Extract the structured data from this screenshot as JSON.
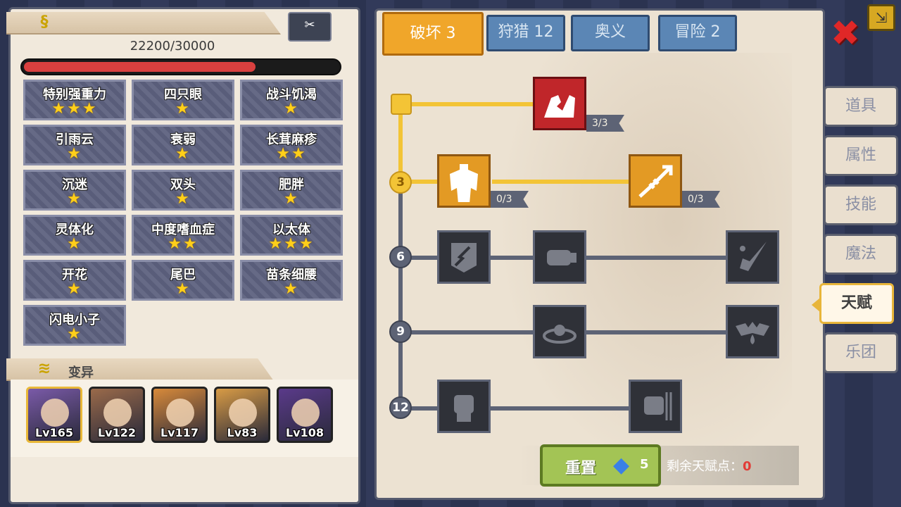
{
  "hp": {
    "text": "22200/30000",
    "fraction": 0.74
  },
  "traits": [
    {
      "name": "特别强重力",
      "stars": 3
    },
    {
      "name": "四只眼",
      "stars": 1
    },
    {
      "name": "战斗饥渴",
      "stars": 1
    },
    {
      "name": "引雨云",
      "stars": 1
    },
    {
      "name": "衰弱",
      "stars": 1
    },
    {
      "name": "长茸麻疹",
      "stars": 2
    },
    {
      "name": "沉迷",
      "stars": 1
    },
    {
      "name": "双头",
      "stars": 1
    },
    {
      "name": "肥胖",
      "stars": 1
    },
    {
      "name": "灵体化",
      "stars": 1
    },
    {
      "name": "中度嗜血症",
      "stars": 2
    },
    {
      "name": "以太体",
      "stars": 3
    },
    {
      "name": "开花",
      "stars": 1
    },
    {
      "name": "尾巴",
      "stars": 1
    },
    {
      "name": "苗条细腰",
      "stars": 1
    },
    {
      "name": "闪电小子",
      "stars": 1
    }
  ],
  "mutation": {
    "label": "变异"
  },
  "characters": [
    {
      "level": "Lv165",
      "selected": true,
      "color": "#7a5aa8"
    },
    {
      "level": "Lv122",
      "selected": false,
      "color": "#9a6a4a"
    },
    {
      "level": "Lv117",
      "selected": false,
      "color": "#d88a3a"
    },
    {
      "level": "Lv83",
      "selected": false,
      "color": "#d89b45"
    },
    {
      "level": "Lv108",
      "selected": false,
      "color": "#5a3a8a"
    }
  ],
  "top_tabs": [
    {
      "label": "破坏 3",
      "active": true
    },
    {
      "label": "狩猎 12",
      "active": false
    },
    {
      "label": "奥义",
      "active": false
    },
    {
      "label": "冒险 2",
      "active": false
    }
  ],
  "tiers": [
    "3",
    "6",
    "9",
    "12"
  ],
  "talents": {
    "arm_wrestle": {
      "icon": "arm-wrestle",
      "progress": "3/3",
      "state": "owned"
    },
    "muscle": {
      "icon": "muscle",
      "progress": "0/3",
      "state": "available"
    },
    "arrow_break": {
      "icon": "arrow-break",
      "progress": "0/3",
      "state": "available"
    },
    "shield_break": {
      "icon": "shield-break",
      "state": "locked"
    },
    "punch": {
      "icon": "punch",
      "state": "locked"
    },
    "splash": {
      "icon": "splash",
      "state": "locked"
    },
    "ripple": {
      "icon": "ripple",
      "state": "locked"
    },
    "bat_drop": {
      "icon": "bat-drop",
      "state": "locked"
    },
    "fist": {
      "icon": "fist",
      "state": "locked"
    },
    "fist_strike": {
      "icon": "fist-strike",
      "state": "locked"
    }
  },
  "reset": {
    "label": "重置",
    "gem_cost": "5"
  },
  "remaining": {
    "label": "剩余天赋点：",
    "value": "0"
  },
  "side_tabs": [
    {
      "label": "道具",
      "active": false
    },
    {
      "label": "属性",
      "active": false
    },
    {
      "label": "技能",
      "active": false
    },
    {
      "label": "魔法",
      "active": false
    },
    {
      "label": "天赋",
      "active": true
    },
    {
      "label": "乐团",
      "active": false
    }
  ],
  "colors": {
    "accent_gold": "#f3c436",
    "hp_red": "#d9403f",
    "active_tab": "#f0a62a",
    "inactive_tab": "#5b86b5"
  }
}
